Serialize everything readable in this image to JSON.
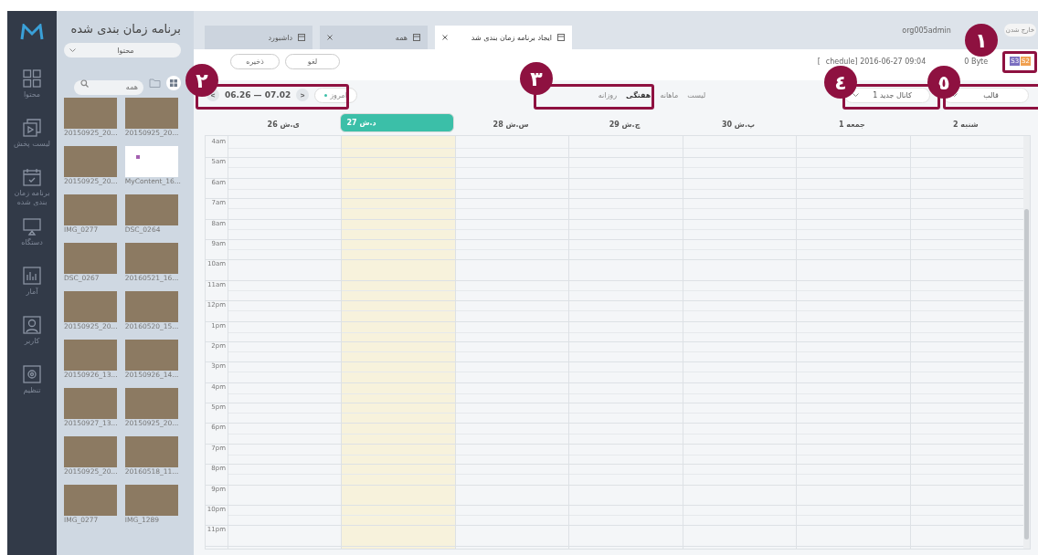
{
  "nav": [
    {
      "label": "محتوا"
    },
    {
      "label": "لیست پخش"
    },
    {
      "label": "برنامه زمان بندی شده"
    },
    {
      "label": "دستگاه"
    },
    {
      "label": "آمار"
    },
    {
      "label": "کاربر"
    },
    {
      "label": "تنظیم"
    }
  ],
  "panel": {
    "title": "برنامه زمان بندی شده",
    "filter": "محتوا",
    "search": {
      "placeholder": "همه"
    },
    "items": [
      {
        "name": "20150925_20...",
        "kind": "photo"
      },
      {
        "name": "20150925_20...",
        "kind": "photo"
      },
      {
        "name": "MyContent_16...",
        "kind": "blank"
      },
      {
        "name": "20150925_20...",
        "kind": "photo"
      },
      {
        "name": "DSC_0264",
        "kind": "photo"
      },
      {
        "name": "IMG_0277",
        "kind": "photo"
      },
      {
        "name": "20160521_16...",
        "kind": "photo"
      },
      {
        "name": "DSC_0267",
        "kind": "photo"
      },
      {
        "name": "20160520_15...",
        "kind": "photo"
      },
      {
        "name": "20150925_20...",
        "kind": "photo"
      },
      {
        "name": "20150926_14...",
        "kind": "photo"
      },
      {
        "name": "20150926_13...",
        "kind": "photo"
      },
      {
        "name": "20150925_20...",
        "kind": "photo"
      },
      {
        "name": "20150927_13...",
        "kind": "photo"
      },
      {
        "name": "20160518_11...",
        "kind": "photo"
      },
      {
        "name": "20150925_20...",
        "kind": "photo"
      },
      {
        "name": "IMG_1289",
        "kind": "photo"
      },
      {
        "name": "IMG_0277",
        "kind": "photo"
      }
    ]
  },
  "tabs": [
    {
      "label": "ایجاد برنامه زمان بندی شد",
      "selected": true,
      "closable": true
    },
    {
      "label": "همه",
      "selected": false,
      "closable": true
    },
    {
      "label": "داشبورد",
      "selected": false,
      "closable": false
    }
  ],
  "user": "org005admin",
  "logout": "خارج شدن",
  "toolbar": {
    "cancel": "لغو",
    "save": "ذخیره",
    "info": "[",
    "schedule": "chedule] 2016-06-27 09:04",
    "size": "0 Byte",
    "badges": [
      {
        "label": "S2",
        "color": "#f0a050"
      },
      {
        "label": "S3",
        "color": "#7b6fc0"
      }
    ]
  },
  "range": {
    "text": "06.26 — 07.02",
    "prev": "<",
    "next": ">",
    "today": "امروز"
  },
  "views": [
    {
      "label": "لیست",
      "selected": false
    },
    {
      "label": "ماهانه",
      "selected": false
    },
    {
      "label": "هفتگی",
      "selected": true
    },
    {
      "label": "روزانه",
      "selected": false
    }
  ],
  "channel": "کانال جدید 1",
  "template": "قالب",
  "days": [
    {
      "label": "شنبه 2",
      "today": false
    },
    {
      "label": "جمعه 1",
      "today": false
    },
    {
      "label": "پ.ش 30",
      "today": false
    },
    {
      "label": "چ.ش 29",
      "today": false
    },
    {
      "label": "س.ش 28",
      "today": false
    },
    {
      "label": "د.ش 27",
      "today": true
    },
    {
      "label": "ی.ش 26",
      "today": false
    }
  ],
  "hours": [
    "4am",
    "5am",
    "6am",
    "7am",
    "8am",
    "9am",
    "10am",
    "11am",
    "12pm",
    "1pm",
    "2pm",
    "3pm",
    "4pm",
    "5pm",
    "6pm",
    "7pm",
    "8pm",
    "9pm",
    "10pm",
    "11pm"
  ],
  "callouts": [
    "١",
    "٥",
    "٤",
    "٣",
    "٢"
  ]
}
